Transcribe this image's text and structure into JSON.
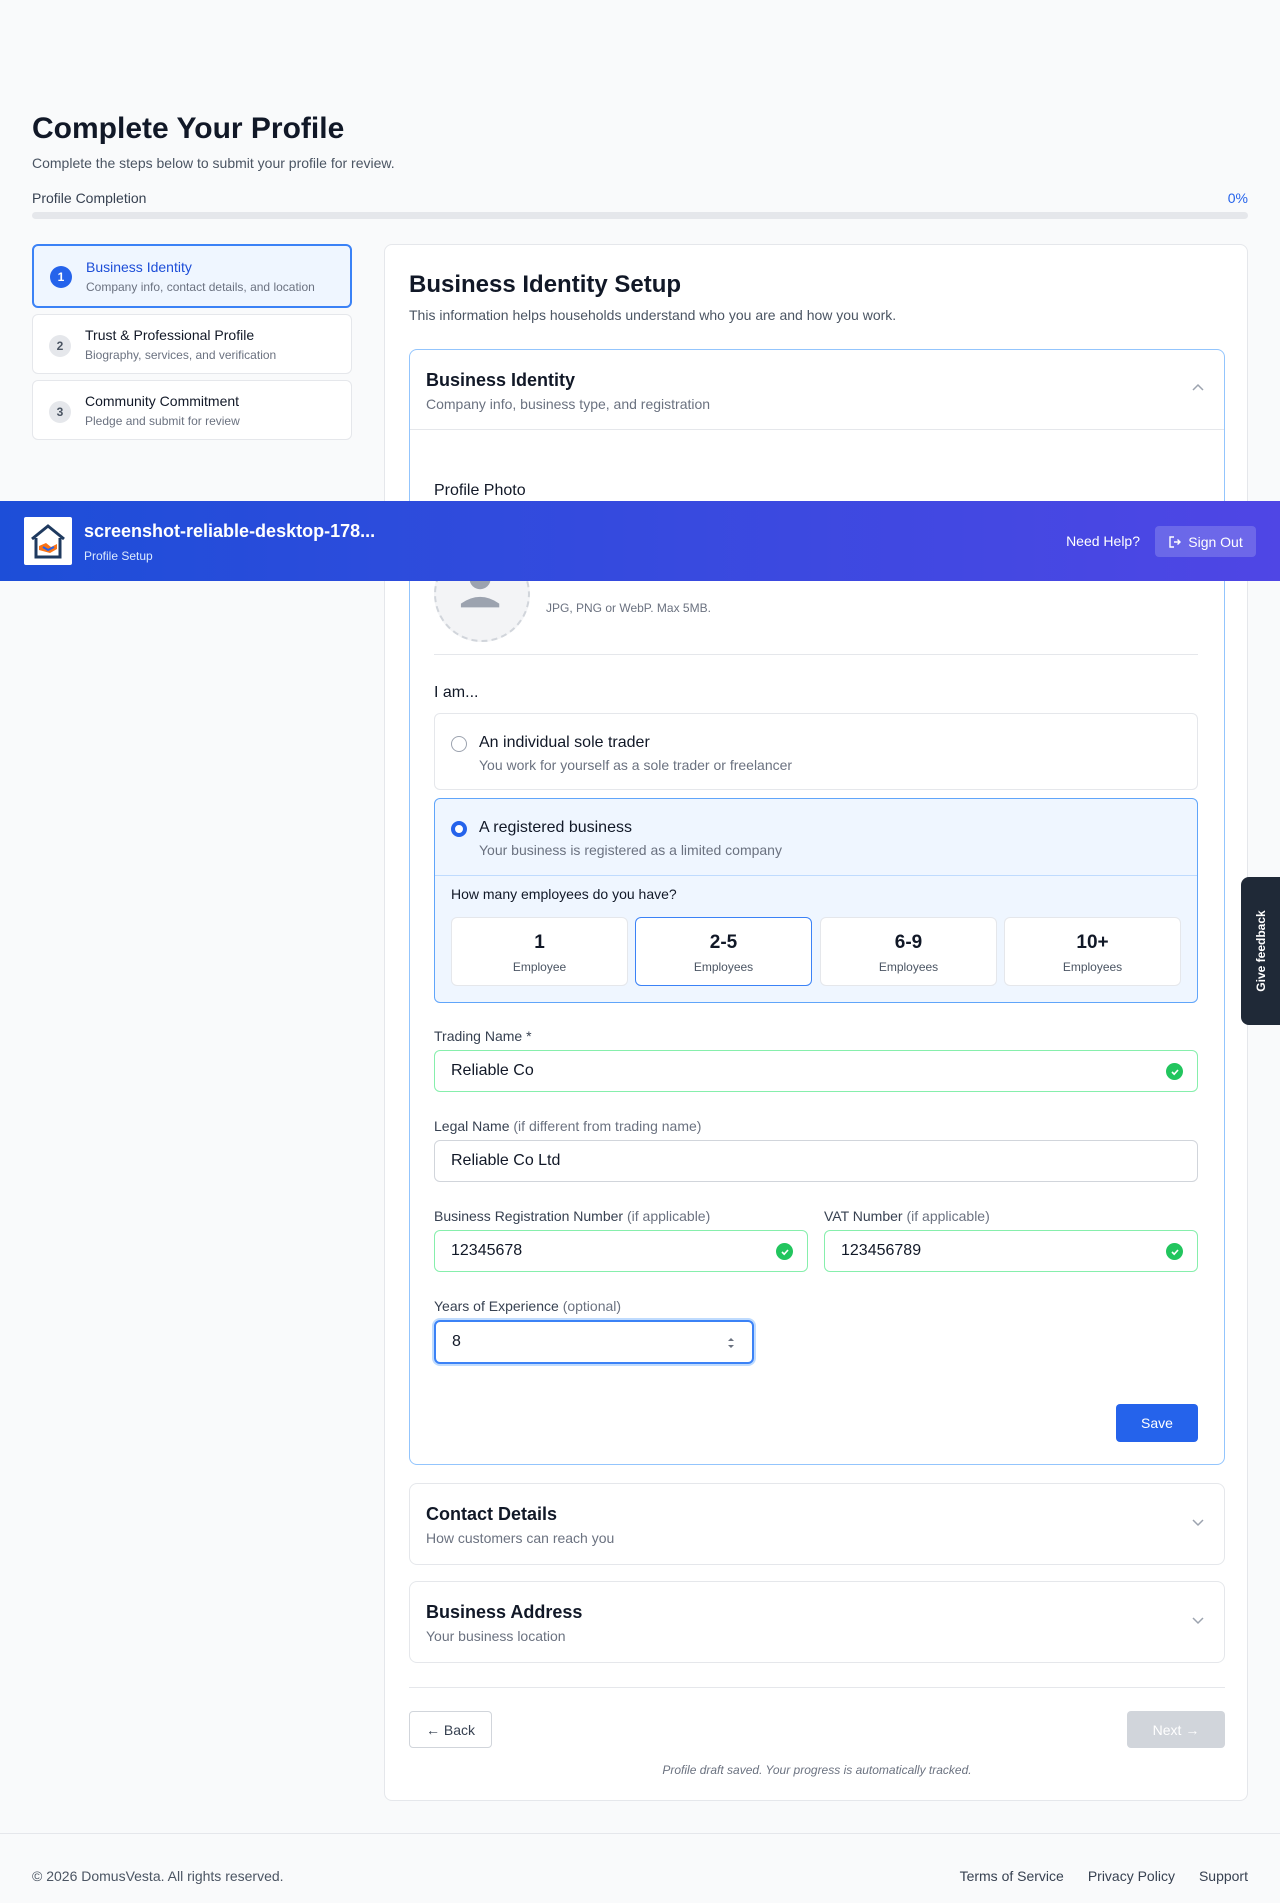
{
  "page": {
    "title": "Complete Your Profile",
    "subtitle": "Complete the steps below to submit your profile for review.",
    "progress_label": "Profile Completion",
    "progress_percent_text": "0%",
    "progress_fraction": 0
  },
  "steps": [
    {
      "number": "1",
      "title": "Business Identity",
      "subtitle": "Company info, contact details, and location"
    },
    {
      "number": "2",
      "title": "Trust & Professional Profile",
      "subtitle": "Biography, services, and verification"
    },
    {
      "number": "3",
      "title": "Community Commitment",
      "subtitle": "Pledge and submit for review"
    }
  ],
  "main": {
    "title": "Business Identity Setup",
    "subtitle": "This information helps households understand who you are and how you work."
  },
  "identity": {
    "title": "Business Identity",
    "subtitle": "Company info, business type, and registration",
    "photo_label": "Profile Photo",
    "photo_hint": "JPG, PNG or WebP. Max 5MB.",
    "iam_label": "I am...",
    "options": [
      {
        "title": "An individual sole trader",
        "subtitle": "You work for yourself as a sole trader or freelancer"
      },
      {
        "title": "A registered business",
        "subtitle": "Your business is registered as a limited company"
      }
    ],
    "employees_question": "How many employees do you have?",
    "employees": [
      {
        "value": "1",
        "label": "Employee"
      },
      {
        "value": "2-5",
        "label": "Employees"
      },
      {
        "value": "6-9",
        "label": "Employees"
      },
      {
        "value": "10+",
        "label": "Employees"
      }
    ],
    "trading_name_label": "Trading Name *",
    "trading_name_value": "Reliable Co",
    "legal_name_label": "Legal Name",
    "legal_name_hint": "(if different from trading name)",
    "legal_name_value": "Reliable Co Ltd",
    "reg_label": "Business Registration Number",
    "reg_hint": "(if applicable)",
    "reg_value": "12345678",
    "vat_label": "VAT Number",
    "vat_hint": "(if applicable)",
    "vat_value": "123456789",
    "years_label": "Years of Experience",
    "years_hint": "(optional)",
    "years_value": "8",
    "save_label": "Save"
  },
  "contact": {
    "title": "Contact Details",
    "subtitle": "How customers can reach you"
  },
  "address": {
    "title": "Business Address",
    "subtitle": "Your business location"
  },
  "nav": {
    "back_label": "← Back",
    "next_label": "Next →",
    "draft_note": "Profile draft saved. Your progress is automatically tracked."
  },
  "header": {
    "app_name": "screenshot-reliable-desktop-178...",
    "app_sub": "Profile Setup",
    "help_label": "Need Help?",
    "signout_label": "Sign Out"
  },
  "feedback": {
    "label": "Give feedback"
  },
  "footer": {
    "copyright": "© 2026 DomusVesta. All rights reserved.",
    "links": [
      "Terms of Service",
      "Privacy Policy",
      "Support"
    ]
  },
  "colors": {
    "accent": "#2563eb",
    "success": "#22c55e",
    "header_start": "#1d4ed8",
    "header_end": "#4f46e5"
  }
}
